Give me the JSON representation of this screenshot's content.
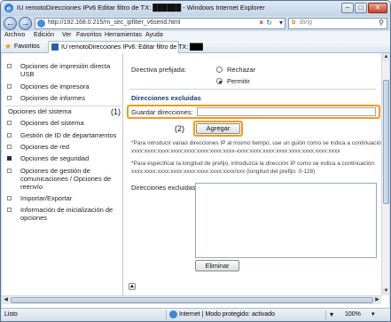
{
  "window": {
    "title": "IU remotoDirecciones IPv6 Editar filtro de TX: ██████ - Windows Internet Explorer"
  },
  "toolbar": {
    "address": "http://192.168.0.215/rn_sec_ipfilter_v6send.html",
    "search_placeholder": "Bing"
  },
  "menu": {
    "items": [
      "Archivo",
      "Edición",
      "Ver",
      "Favoritos",
      "Herramientas",
      "Ayuda"
    ]
  },
  "favorites": {
    "label": "Favoritos",
    "tab_label": "IU remotoDirecciones IPv6: Editar filtro de TX: ███"
  },
  "sidebar": {
    "items_top": [
      {
        "label": "Opciones de impresión directa USB"
      },
      {
        "label": "Opciones de impresora"
      },
      {
        "label": "Opciones de informes"
      }
    ],
    "section": "Opciones del sistema",
    "items_bottom": [
      {
        "label": "Opciones del sistema"
      },
      {
        "label": "Gestión de ID de departamentos"
      },
      {
        "label": "Opciones de red"
      },
      {
        "label": "Opciones de seguridad",
        "selected": true
      },
      {
        "label": "Opciones de gestión de comunicaciones / Opciones de reenvío"
      },
      {
        "label": "Importar/Exportar"
      },
      {
        "label": "Información de inicialización de opciones"
      }
    ]
  },
  "main": {
    "policy_label": "Directiva prefijada:",
    "reject_label": "Rechazar",
    "allow_label": "Permitir",
    "allow_selected": true,
    "excluded_title": "Direcciones excluidas",
    "save_label": "Guardar direcciones:",
    "save_value": "",
    "add_button": "Agregar",
    "note1": "*Para introducir varias direcciones IP al mismo tiempo, use un guión como se indica a continuación:",
    "note1_example": "xxxx:xxxx:xxxx:xxxx:xxxx:xxxx:xxxx:xxxx-xxxx:xxxx:xxxx:xxxx:xxxx:xxxx:xxxx:xxxx",
    "note2": "*Para especificar la longitud de prefijo, introduzca la dirección IP como se indica a continuación:",
    "note2_example": "xxxx:xxxx:xxxx:xxxx:xxxx:xxxx:xxxx:xxxx/xxx (longitud del prefijo: 0-128)",
    "excluded_label": "Direcciones excluidas:",
    "delete_button": "Eliminar"
  },
  "callouts": {
    "one": "(1)",
    "two": "(2)"
  },
  "status": {
    "left": "Listo",
    "zone": "Internet | Modo protegido: activado",
    "zoom": "100%"
  },
  "colors": {
    "highlight": "#f39a1a",
    "section_title": "#1d3870"
  },
  "icons": [
    "back-icon",
    "forward-icon",
    "globe-icon",
    "refresh-icon",
    "stop-icon",
    "search-icon",
    "star-icon",
    "page-icon",
    "top-icon"
  ]
}
